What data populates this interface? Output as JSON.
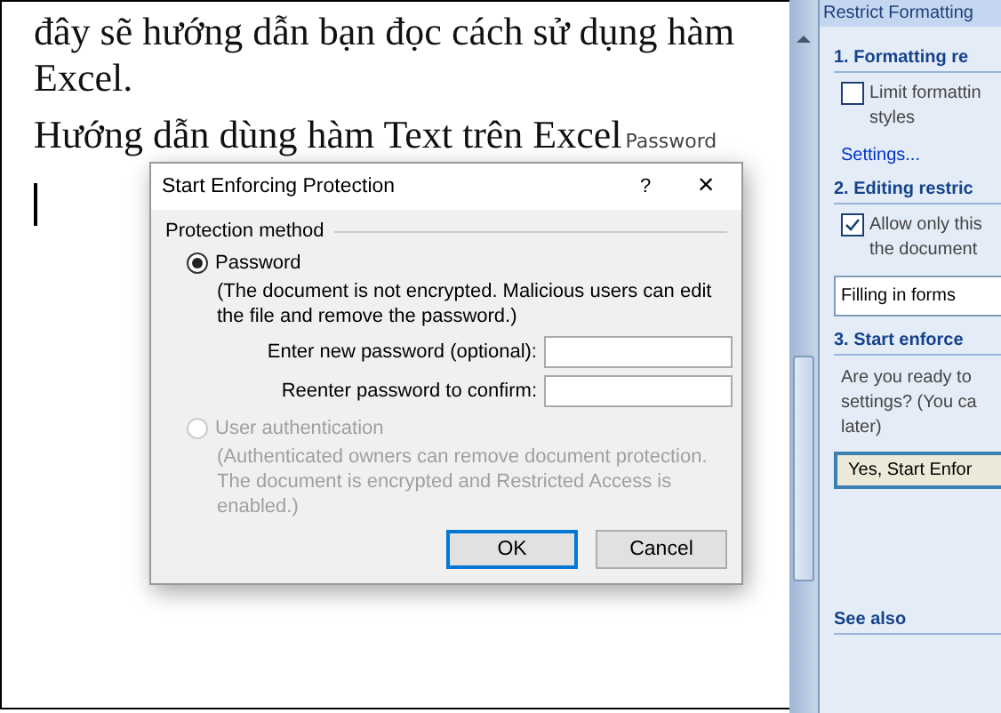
{
  "document": {
    "lines": [
      "đây sẽ hướng dẫn bạn đọc cách sử dụng hàm",
      "Excel.",
      "Hướng dẫn dùng hàm Text trên Excel"
    ],
    "behind_text": "Password"
  },
  "dialog": {
    "title": "Start Enforcing Protection",
    "help": "?",
    "close": "×",
    "group": "Protection method",
    "options": [
      {
        "label": "Password",
        "selected": true,
        "disabled": false,
        "note": "(The document is not encrypted. Malicious users can edit the file and remove the password.)"
      },
      {
        "label": "User authentication",
        "selected": false,
        "disabled": true,
        "note": "(Authenticated owners can remove document protection. The document is encrypted and Restricted Access is enabled.)"
      }
    ],
    "fields": [
      {
        "label": "Enter new password (optional):"
      },
      {
        "label": "Reenter password to confirm:"
      }
    ],
    "buttons": [
      {
        "label": "OK",
        "default": true
      },
      {
        "label": "Cancel",
        "default": false
      }
    ]
  },
  "task_pane": {
    "title": "Restrict Formatting",
    "items": [
      {
        "kind": "heading",
        "text": "1. Formatting re"
      },
      {
        "kind": "checkbox",
        "checked": false,
        "lines": [
          "Limit formattin",
          "styles"
        ]
      },
      {
        "kind": "link",
        "text": "Settings..."
      },
      {
        "kind": "heading",
        "text": "2. Editing restric"
      },
      {
        "kind": "checkbox",
        "checked": true,
        "lines": [
          "Allow only this",
          "the document"
        ]
      },
      {
        "kind": "dropdown",
        "text": "Filling in forms"
      },
      {
        "kind": "heading",
        "text": "3. Start enforce"
      },
      {
        "kind": "text",
        "lines": [
          "Are you ready to",
          "settings? (You ca",
          "later)"
        ]
      },
      {
        "kind": "button",
        "text": "Yes, Start Enfor"
      },
      {
        "kind": "heading",
        "text": "See also"
      }
    ]
  }
}
